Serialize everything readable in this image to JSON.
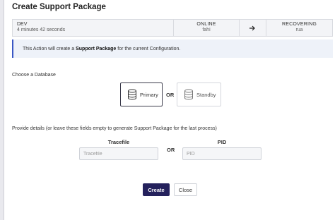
{
  "dialog": {
    "title": "Create Support Package"
  },
  "status": {
    "env_name": "DEV",
    "uptime": "4 minutes 42 seconds",
    "primary_state": "ONLINE",
    "primary_host": "fahi",
    "arrow_icon": "arrow-right-icon",
    "standby_state": "RECOVERING",
    "standby_host": "rua"
  },
  "banner": {
    "prefix": "This Action will create a ",
    "highlight": "Support Package",
    "suffix": " for the current Configuration."
  },
  "database": {
    "label": "Choose a Database",
    "primary_label": "Primary",
    "standby_label": "Standby",
    "or_text": "OR",
    "selected": "Primary"
  },
  "details": {
    "label": "Provide details (or leave these fields empty to generate Support Package for the last process)",
    "tracefile_label": "Tracefile",
    "tracefile_placeholder": "Tracefile",
    "tracefile_value": "",
    "pid_label": "PID",
    "pid_placeholder": "PID",
    "pid_value": "",
    "or_text": "OR"
  },
  "actions": {
    "create_label": "Create",
    "close_label": "Close"
  },
  "colors": {
    "primary_button": "#24215c",
    "banner_accent": "#3a57c4",
    "banner_bg": "#eef2f9"
  }
}
